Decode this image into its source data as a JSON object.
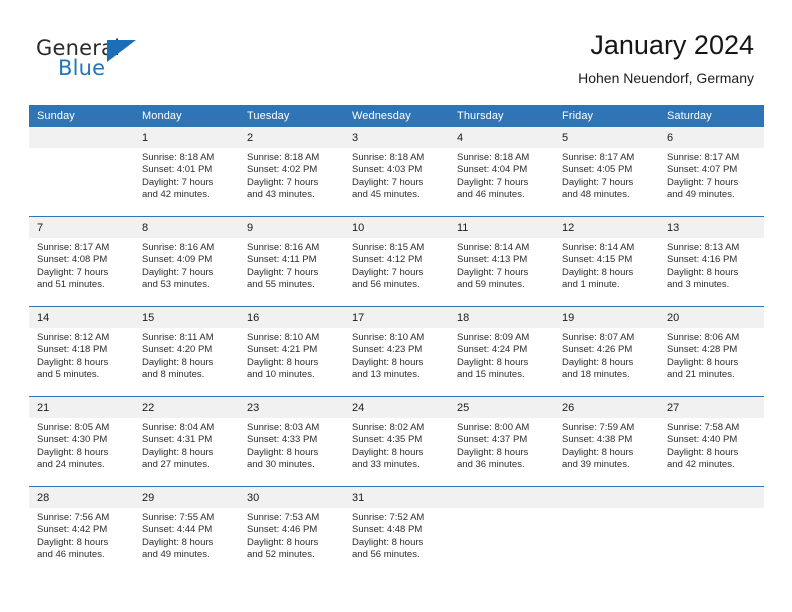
{
  "brand": {
    "word_one": "General",
    "word_two": "Blue",
    "triangle_icon": "triangle-icon",
    "accent_color": "#2176bd"
  },
  "header": {
    "title": "January 2024",
    "subtitle": "Hohen Neuendorf, Germany"
  },
  "calendar": {
    "header_color": "#2f74b5",
    "daynum_band_color": "#f1f1f1",
    "weekdays": [
      "Sunday",
      "Monday",
      "Tuesday",
      "Wednesday",
      "Thursday",
      "Friday",
      "Saturday"
    ],
    "weeks": [
      [
        {
          "day": "",
          "sunrise": "",
          "sunset": "",
          "daylight_1": "",
          "daylight_2": ""
        },
        {
          "day": "1",
          "sunrise": "Sunrise: 8:18 AM",
          "sunset": "Sunset: 4:01 PM",
          "daylight_1": "Daylight: 7 hours",
          "daylight_2": "and 42 minutes."
        },
        {
          "day": "2",
          "sunrise": "Sunrise: 8:18 AM",
          "sunset": "Sunset: 4:02 PM",
          "daylight_1": "Daylight: 7 hours",
          "daylight_2": "and 43 minutes."
        },
        {
          "day": "3",
          "sunrise": "Sunrise: 8:18 AM",
          "sunset": "Sunset: 4:03 PM",
          "daylight_1": "Daylight: 7 hours",
          "daylight_2": "and 45 minutes."
        },
        {
          "day": "4",
          "sunrise": "Sunrise: 8:18 AM",
          "sunset": "Sunset: 4:04 PM",
          "daylight_1": "Daylight: 7 hours",
          "daylight_2": "and 46 minutes."
        },
        {
          "day": "5",
          "sunrise": "Sunrise: 8:17 AM",
          "sunset": "Sunset: 4:05 PM",
          "daylight_1": "Daylight: 7 hours",
          "daylight_2": "and 48 minutes."
        },
        {
          "day": "6",
          "sunrise": "Sunrise: 8:17 AM",
          "sunset": "Sunset: 4:07 PM",
          "daylight_1": "Daylight: 7 hours",
          "daylight_2": "and 49 minutes."
        }
      ],
      [
        {
          "day": "7",
          "sunrise": "Sunrise: 8:17 AM",
          "sunset": "Sunset: 4:08 PM",
          "daylight_1": "Daylight: 7 hours",
          "daylight_2": "and 51 minutes."
        },
        {
          "day": "8",
          "sunrise": "Sunrise: 8:16 AM",
          "sunset": "Sunset: 4:09 PM",
          "daylight_1": "Daylight: 7 hours",
          "daylight_2": "and 53 minutes."
        },
        {
          "day": "9",
          "sunrise": "Sunrise: 8:16 AM",
          "sunset": "Sunset: 4:11 PM",
          "daylight_1": "Daylight: 7 hours",
          "daylight_2": "and 55 minutes."
        },
        {
          "day": "10",
          "sunrise": "Sunrise: 8:15 AM",
          "sunset": "Sunset: 4:12 PM",
          "daylight_1": "Daylight: 7 hours",
          "daylight_2": "and 56 minutes."
        },
        {
          "day": "11",
          "sunrise": "Sunrise: 8:14 AM",
          "sunset": "Sunset: 4:13 PM",
          "daylight_1": "Daylight: 7 hours",
          "daylight_2": "and 59 minutes."
        },
        {
          "day": "12",
          "sunrise": "Sunrise: 8:14 AM",
          "sunset": "Sunset: 4:15 PM",
          "daylight_1": "Daylight: 8 hours",
          "daylight_2": "and 1 minute."
        },
        {
          "day": "13",
          "sunrise": "Sunrise: 8:13 AM",
          "sunset": "Sunset: 4:16 PM",
          "daylight_1": "Daylight: 8 hours",
          "daylight_2": "and 3 minutes."
        }
      ],
      [
        {
          "day": "14",
          "sunrise": "Sunrise: 8:12 AM",
          "sunset": "Sunset: 4:18 PM",
          "daylight_1": "Daylight: 8 hours",
          "daylight_2": "and 5 minutes."
        },
        {
          "day": "15",
          "sunrise": "Sunrise: 8:11 AM",
          "sunset": "Sunset: 4:20 PM",
          "daylight_1": "Daylight: 8 hours",
          "daylight_2": "and 8 minutes."
        },
        {
          "day": "16",
          "sunrise": "Sunrise: 8:10 AM",
          "sunset": "Sunset: 4:21 PM",
          "daylight_1": "Daylight: 8 hours",
          "daylight_2": "and 10 minutes."
        },
        {
          "day": "17",
          "sunrise": "Sunrise: 8:10 AM",
          "sunset": "Sunset: 4:23 PM",
          "daylight_1": "Daylight: 8 hours",
          "daylight_2": "and 13 minutes."
        },
        {
          "day": "18",
          "sunrise": "Sunrise: 8:09 AM",
          "sunset": "Sunset: 4:24 PM",
          "daylight_1": "Daylight: 8 hours",
          "daylight_2": "and 15 minutes."
        },
        {
          "day": "19",
          "sunrise": "Sunrise: 8:07 AM",
          "sunset": "Sunset: 4:26 PM",
          "daylight_1": "Daylight: 8 hours",
          "daylight_2": "and 18 minutes."
        },
        {
          "day": "20",
          "sunrise": "Sunrise: 8:06 AM",
          "sunset": "Sunset: 4:28 PM",
          "daylight_1": "Daylight: 8 hours",
          "daylight_2": "and 21 minutes."
        }
      ],
      [
        {
          "day": "21",
          "sunrise": "Sunrise: 8:05 AM",
          "sunset": "Sunset: 4:30 PM",
          "daylight_1": "Daylight: 8 hours",
          "daylight_2": "and 24 minutes."
        },
        {
          "day": "22",
          "sunrise": "Sunrise: 8:04 AM",
          "sunset": "Sunset: 4:31 PM",
          "daylight_1": "Daylight: 8 hours",
          "daylight_2": "and 27 minutes."
        },
        {
          "day": "23",
          "sunrise": "Sunrise: 8:03 AM",
          "sunset": "Sunset: 4:33 PM",
          "daylight_1": "Daylight: 8 hours",
          "daylight_2": "and 30 minutes."
        },
        {
          "day": "24",
          "sunrise": "Sunrise: 8:02 AM",
          "sunset": "Sunset: 4:35 PM",
          "daylight_1": "Daylight: 8 hours",
          "daylight_2": "and 33 minutes."
        },
        {
          "day": "25",
          "sunrise": "Sunrise: 8:00 AM",
          "sunset": "Sunset: 4:37 PM",
          "daylight_1": "Daylight: 8 hours",
          "daylight_2": "and 36 minutes."
        },
        {
          "day": "26",
          "sunrise": "Sunrise: 7:59 AM",
          "sunset": "Sunset: 4:38 PM",
          "daylight_1": "Daylight: 8 hours",
          "daylight_2": "and 39 minutes."
        },
        {
          "day": "27",
          "sunrise": "Sunrise: 7:58 AM",
          "sunset": "Sunset: 4:40 PM",
          "daylight_1": "Daylight: 8 hours",
          "daylight_2": "and 42 minutes."
        }
      ],
      [
        {
          "day": "28",
          "sunrise": "Sunrise: 7:56 AM",
          "sunset": "Sunset: 4:42 PM",
          "daylight_1": "Daylight: 8 hours",
          "daylight_2": "and 46 minutes."
        },
        {
          "day": "29",
          "sunrise": "Sunrise: 7:55 AM",
          "sunset": "Sunset: 4:44 PM",
          "daylight_1": "Daylight: 8 hours",
          "daylight_2": "and 49 minutes."
        },
        {
          "day": "30",
          "sunrise": "Sunrise: 7:53 AM",
          "sunset": "Sunset: 4:46 PM",
          "daylight_1": "Daylight: 8 hours",
          "daylight_2": "and 52 minutes."
        },
        {
          "day": "31",
          "sunrise": "Sunrise: 7:52 AM",
          "sunset": "Sunset: 4:48 PM",
          "daylight_1": "Daylight: 8 hours",
          "daylight_2": "and 56 minutes."
        },
        {
          "day": "",
          "sunrise": "",
          "sunset": "",
          "daylight_1": "",
          "daylight_2": ""
        },
        {
          "day": "",
          "sunrise": "",
          "sunset": "",
          "daylight_1": "",
          "daylight_2": ""
        },
        {
          "day": "",
          "sunrise": "",
          "sunset": "",
          "daylight_1": "",
          "daylight_2": ""
        }
      ]
    ]
  }
}
